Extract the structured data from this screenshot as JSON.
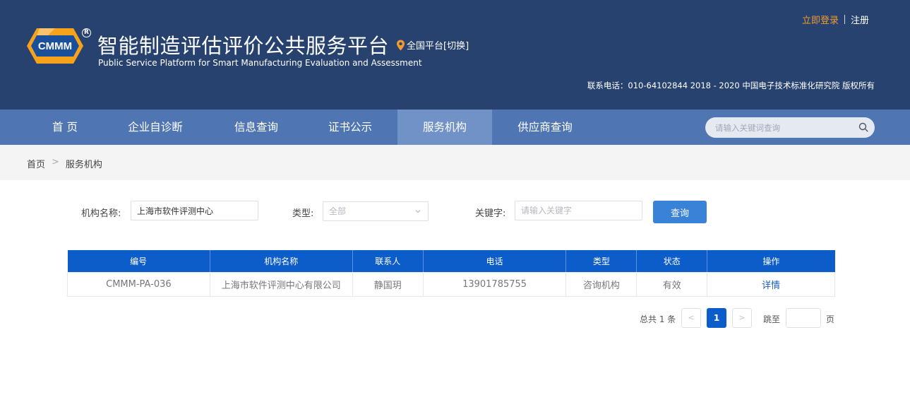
{
  "header": {
    "logo_text": "CMMM",
    "reg_mark": "R",
    "title_zh": "智能制造评估评价公共服务平台",
    "title_en": "Public Service Platform for Smart Manufacturing Evaluation and Assessment",
    "region": "全国平台[切换]",
    "login": "立即登录",
    "register": "注册",
    "contact": "联系电话：010-64102844  2018 - 2020 中国电子技术标准化研究院 版权所有"
  },
  "nav": {
    "items": [
      "首 页",
      "企业自诊断",
      "信息查询",
      "证书公示",
      "服务机构",
      "供应商查询"
    ],
    "active_index": 4,
    "search_placeholder": "请输入关键词查询"
  },
  "breadcrumb": {
    "home": "首页",
    "separator": ">",
    "current": "服务机构"
  },
  "filter": {
    "org_name_label": "机构名称:",
    "org_name_value": "上海市软件评测中心",
    "type_label": "类型:",
    "type_value": "全部",
    "keyword_label": "关键字:",
    "keyword_placeholder": "请输入关键字",
    "query_button": "查询"
  },
  "table": {
    "headers": [
      "编号",
      "机构名称",
      "联系人",
      "电话",
      "类型",
      "状态",
      "操作"
    ],
    "rows": [
      [
        "CMMM-PA-036",
        "上海市软件评测中心有限公司",
        "静国玥",
        "13901785755",
        "咨询机构",
        "有效",
        "详情"
      ]
    ]
  },
  "pagination": {
    "total": "总共 1 条",
    "prev": "<",
    "current": "1",
    "next": ">",
    "goto_label": "跳至",
    "goto_suffix": "页"
  },
  "colors": {
    "header_bg": "#27426f",
    "nav_bg": "#4f76b3",
    "nav_active": "#7092c6",
    "table_head": "#0c5cc9",
    "accent_orange": "#f29a2e",
    "button_blue": "#3a82d8"
  }
}
